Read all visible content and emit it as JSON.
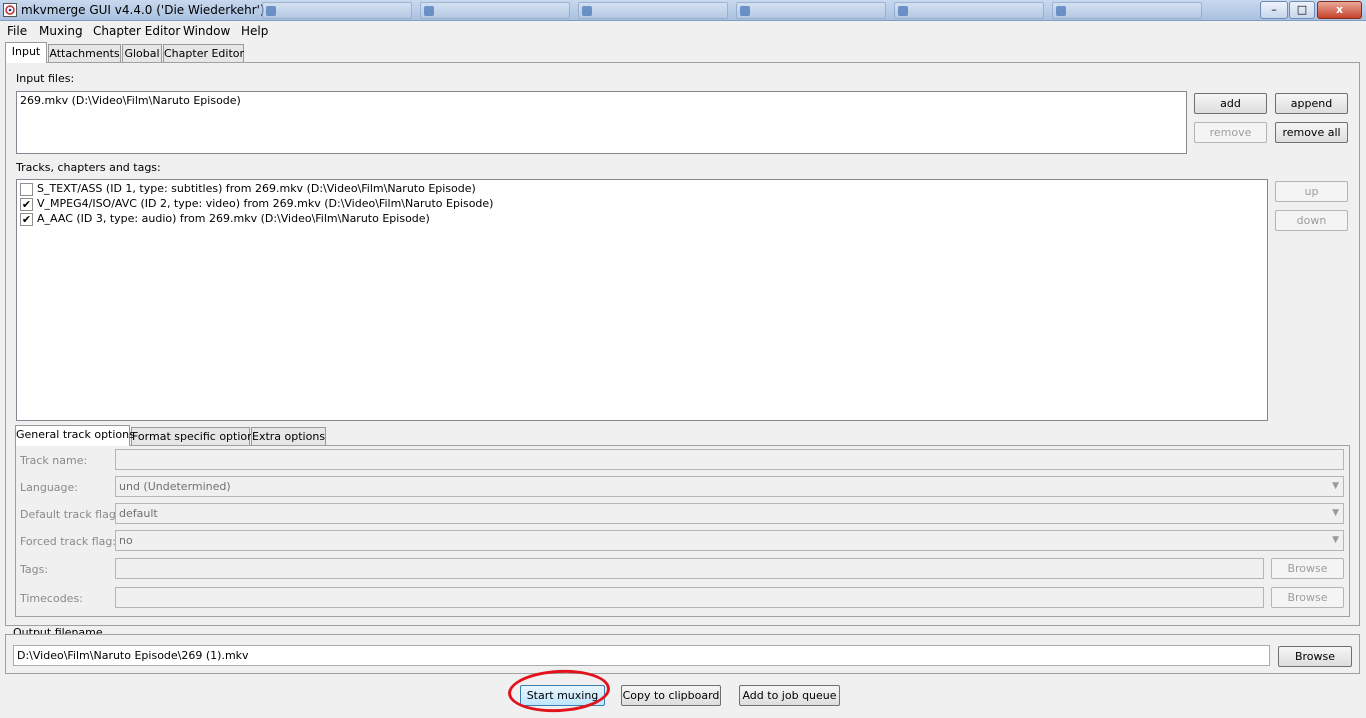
{
  "window": {
    "title": "mkvmerge GUI v4.4.0 ('Die Wiederkehr')",
    "minimize_glyph": "–",
    "maximize_glyph": "□",
    "close_glyph": "x"
  },
  "menu": [
    "File",
    "Muxing",
    "Chapter Editor",
    "Window",
    "Help"
  ],
  "main_tabs": [
    "Input",
    "Attachments",
    "Global",
    "Chapter Editor"
  ],
  "input": {
    "input_files_label": "Input files:",
    "files": [
      "269.mkv (D:\\Video\\Film\\Naruto Episode)"
    ],
    "buttons": {
      "add": "add",
      "append": "append",
      "remove": "remove",
      "remove_all": "remove all"
    },
    "tracks_label": "Tracks, chapters and tags:",
    "tracks": [
      {
        "checked": false,
        "text": "S_TEXT/ASS (ID 1, type: subtitles) from 269.mkv (D:\\Video\\Film\\Naruto Episode)"
      },
      {
        "checked": true,
        "text": "V_MPEG4/ISO/AVC (ID 2, type: video) from 269.mkv (D:\\Video\\Film\\Naruto Episode)"
      },
      {
        "checked": true,
        "text": "A_AAC (ID 3, type: audio) from 269.mkv (D:\\Video\\Film\\Naruto Episode)"
      }
    ],
    "check_glyph": "✔",
    "track_buttons": {
      "up": "up",
      "down": "down"
    }
  },
  "option_tabs": [
    "General track options",
    "Format specific options",
    "Extra options"
  ],
  "general_options": {
    "track_name_label": "Track name:",
    "track_name_value": "",
    "language_label": "Language:",
    "language_value": "und (Undetermined)",
    "default_flag_label": "Default track flag:",
    "default_flag_value": "default",
    "forced_flag_label": "Forced track flag:",
    "forced_flag_value": "no",
    "tags_label": "Tags:",
    "tags_value": "",
    "timecodes_label": "Timecodes:",
    "timecodes_value": "",
    "browse": "Browse",
    "dropdown_glyph": "▼"
  },
  "output": {
    "label": "Output filename",
    "value": "D:\\Video\\Film\\Naruto Episode\\269 (1).mkv",
    "browse": "Browse"
  },
  "actions": {
    "start_muxing": "Start muxing",
    "copy_to_clipboard": "Copy to clipboard",
    "add_to_job_queue": "Add to job queue"
  },
  "colors": {
    "annotation": "#e1141e"
  }
}
